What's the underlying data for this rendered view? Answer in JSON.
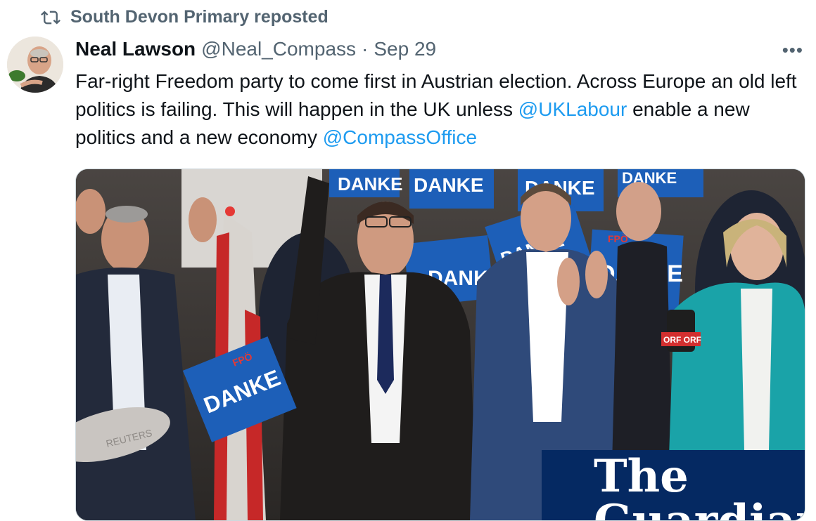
{
  "repost": {
    "icon": "repost-icon",
    "text": "South Devon Primary reposted"
  },
  "tweet": {
    "author_name": "Neal Lawson",
    "author_handle": "@Neal_Compass",
    "separator": "·",
    "date": "Sep 29",
    "more_icon": "more-options-icon",
    "more_label": "•••",
    "text_part1": "Far-right Freedom party to come first in Austrian election. Across Europe an old left politics is failing. This will happen in the UK unless ",
    "mention1": "@UKLabour",
    "text_part2": " enable a new politics and a new economy ",
    "mention2": "@CompassOffice"
  },
  "media": {
    "signs": [
      "DANKE",
      "DANKE",
      "DANKE",
      "DANKE",
      "DANKE",
      "DANKE",
      "DANKE",
      "DANKE"
    ],
    "sign_party": "FPÖ",
    "orf_label": "ORF ORF",
    "mic_label": "REUTERS",
    "watermark_line1": "The",
    "watermark_line2": "Guardian"
  },
  "colors": {
    "link": "#1d9bf0",
    "secondary_text": "#536471",
    "sign_blue": "#1d5fb8",
    "guardian_blue": "#052962",
    "teal_jacket": "#1aa3a8"
  }
}
